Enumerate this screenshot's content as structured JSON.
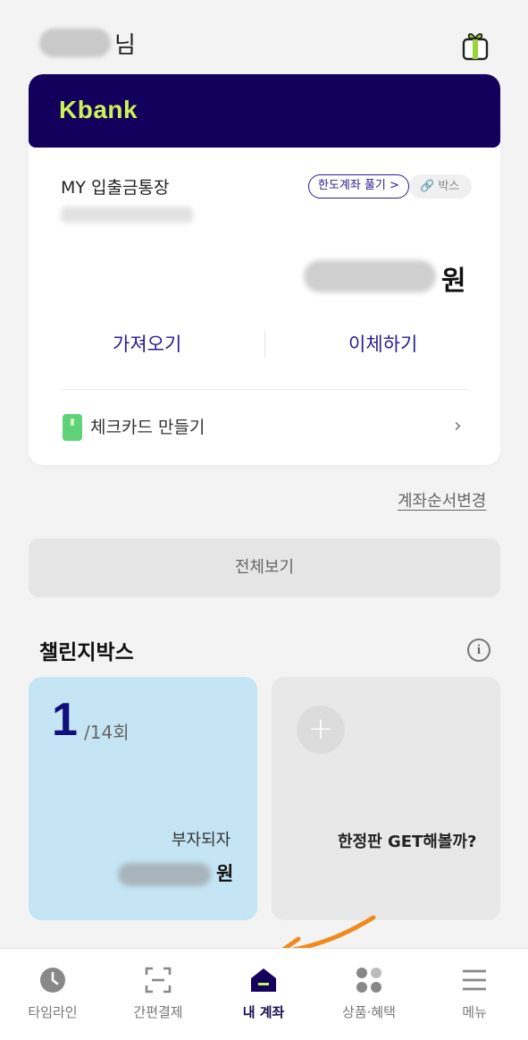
{
  "header": {
    "name_suffix": "님",
    "gift_icon": "gift-icon"
  },
  "account": {
    "brand": "Kbank",
    "name": "MY 입출금통장",
    "limit_button": "한도계좌 풀기 >",
    "box_badge": "🔗 박스",
    "balance_unit": "원",
    "actions": [
      "가져오기",
      "이체하기"
    ],
    "check_card": "체크카드 만들기",
    "chevron": "›"
  },
  "reorder_link": "계좌순서변경",
  "view_all": "전체보기",
  "challenge": {
    "title": "챌린지박스",
    "info_icon": "i",
    "tile": {
      "count": "1",
      "total": "/14회",
      "name": "부자되자",
      "amount_unit": "원"
    },
    "add_tile": {
      "plus": "+",
      "label": "한정판 GET해볼까?"
    }
  },
  "colors": {
    "brand_navy": "#12005c",
    "brand_lime": "#cdf254",
    "accent": "#2a1c8f",
    "tile_blue": "#c5e5f5",
    "arrow": "#f08a1c"
  },
  "nav": {
    "items": [
      {
        "label": "타임라인",
        "icon": "clock-icon",
        "active": false
      },
      {
        "label": "간편결제",
        "icon": "scan-icon",
        "active": false
      },
      {
        "label": "내 계좌",
        "icon": "home-icon",
        "active": true
      },
      {
        "label": "상품·혜택",
        "icon": "grid-icon",
        "active": false
      },
      {
        "label": "메뉴",
        "icon": "menu-icon",
        "active": false
      }
    ]
  }
}
